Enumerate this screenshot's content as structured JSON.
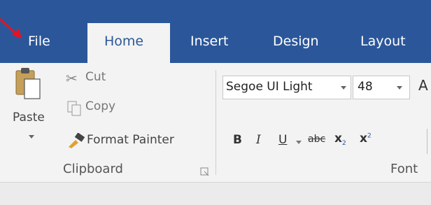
{
  "annotation": {
    "arrow_color": "#e81123"
  },
  "tabs": [
    {
      "label": "File"
    },
    {
      "label": "Home"
    },
    {
      "label": "Insert"
    },
    {
      "label": "Design"
    },
    {
      "label": "Layout"
    }
  ],
  "clipboard": {
    "paste_label": "Paste",
    "cut_label": "Cut",
    "copy_label": "Copy",
    "format_painter_label": "Format Painter",
    "group_label": "Clipboard"
  },
  "font": {
    "font_name": "Segoe UI Light",
    "font_size": "48",
    "bold_glyph": "B",
    "italic_glyph": "I",
    "underline_glyph": "U",
    "strike_glyph": "abc",
    "subscript_glyph": "x",
    "superscript_glyph": "x",
    "grow_glyph": "A",
    "group_label": "Font"
  },
  "colors": {
    "accent": "#2b579a",
    "ribbon_bg": "#f3f3f3"
  }
}
